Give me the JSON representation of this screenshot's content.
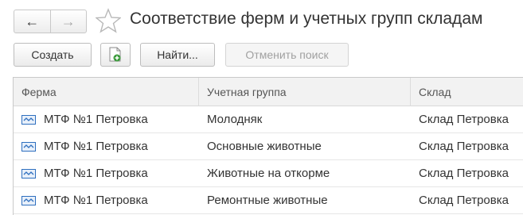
{
  "window": {
    "title": "Соответствие ферм и учетных групп складам",
    "nav_back_icon": "←",
    "nav_forward_icon": "→"
  },
  "toolbar": {
    "create_label": "Создать",
    "find_label": "Найти...",
    "cancel_search_label": "Отменить поиск"
  },
  "table": {
    "columns": [
      "Ферма",
      "Учетная группа",
      "Склад"
    ],
    "rows": [
      {
        "farm": "МТФ №1 Петровка",
        "group": "Молодняк",
        "warehouse": "Склад Петровка"
      },
      {
        "farm": "МТФ №1 Петровка",
        "group": "Основные животные",
        "warehouse": "Склад Петровка"
      },
      {
        "farm": "МТФ №1 Петровка",
        "group": "Животные на откорме",
        "warehouse": "Склад Петровка"
      },
      {
        "farm": "МТФ №1 Петровка",
        "group": "Ремонтные животные",
        "warehouse": "Склад Петровка"
      }
    ]
  },
  "colors": {
    "accent_green": "#3a9a3a",
    "row_icon_blue": "#2e6fbf",
    "disabled_text": "#a0a0a0"
  }
}
